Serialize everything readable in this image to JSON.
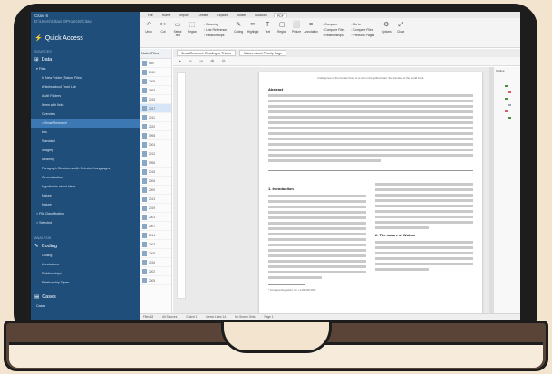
{
  "sidebar": {
    "app_title": "Citavi 6",
    "project_path": "D:\\Users\\Citavi 6\\Projects\\Citavi",
    "quick_access_label": "Quick Access",
    "section_sources": "SOURCES",
    "data_label": "Data",
    "files_label": "Files",
    "items": [
      {
        "label": "In New Folder (Saturn Files)",
        "active": false,
        "sub": false
      },
      {
        "label": "Articles about Trust Lab",
        "active": false,
        "sub": false
      },
      {
        "label": "Audit Folders",
        "active": false,
        "sub": false
      },
      {
        "label": "Items with links",
        "active": false,
        "sub": false
      },
      {
        "label": "Overview",
        "active": false,
        "sub": false
      },
      {
        "label": "> SmartResearch",
        "active": true,
        "sub": false
      },
      {
        "label": "bbs",
        "active": false,
        "sub": false
      },
      {
        "label": "Standard",
        "active": false,
        "sub": false
      },
      {
        "label": "Imagery",
        "active": false,
        "sub": false
      },
      {
        "label": "Meaning",
        "active": false,
        "sub": false
      },
      {
        "label": "Paragraph Structures with Selected Languages",
        "active": false,
        "sub": false
      },
      {
        "label": "Generalization",
        "active": false,
        "sub": false
      },
      {
        "label": "Hypothesis about ideas",
        "active": false,
        "sub": false
      },
      {
        "label": "Nature",
        "active": false,
        "sub": false
      },
      {
        "label": "Nature",
        "active": false,
        "sub": false
      },
      {
        "label": "> File Classification",
        "active": false,
        "sub": true
      },
      {
        "label": "> Selected",
        "active": false,
        "sub": true
      }
    ],
    "section_analysis": "ANALYSIS",
    "coding_label": "Coding",
    "coding_items": [
      "Coding",
      "Annotations",
      "Relationships",
      "Relationship Types"
    ],
    "cases_label": "Cases",
    "cases_sub": "Cases"
  },
  "ribbon": {
    "tabs": [
      "File",
      "Home",
      "Import",
      "Create",
      "Explore",
      "Share",
      "Modules",
      "PDF"
    ],
    "active_tab": "PDF",
    "tools": [
      {
        "icon": "↶",
        "label": "Undo"
      },
      {
        "icon": "✂",
        "label": "Cut"
      },
      {
        "icon": "▭",
        "label": "Select Text"
      },
      {
        "icon": "⬚",
        "label": "Region"
      }
    ],
    "group1": [
      "Cleaning",
      "Line Reference",
      "Relationships"
    ],
    "tools2": [
      {
        "icon": "✎",
        "label": "Coding"
      },
      {
        "icon": "✏",
        "label": "Highlight"
      },
      {
        "icon": "T",
        "label": "Text"
      },
      {
        "icon": "▢",
        "label": "Region"
      },
      {
        "icon": "⬜",
        "label": "Picture"
      },
      {
        "icon": "⌗",
        "label": "Annotation"
      }
    ],
    "group2": [
      "Compare",
      "Compare Files",
      "Relationships"
    ],
    "group3": [
      "Go to",
      "Compare Files",
      "Previous Pages"
    ],
    "tools3": [
      {
        "icon": "⚙",
        "label": "Options"
      },
      {
        "icon": "⤢",
        "label": "Close"
      }
    ]
  },
  "reflist": {
    "header": "Notes/Files",
    "rows": [
      "Fan",
      "2010",
      "2009",
      "1993",
      "2015",
      "2017",
      "2011",
      "2020",
      "1998",
      "2004",
      "2012",
      "1996",
      "2018",
      "2006",
      "2000",
      "2013",
      "2019",
      "2001",
      "2007",
      "2014",
      "2003",
      "2008",
      "2016",
      "2002",
      "2005"
    ],
    "active_index": 5
  },
  "doc_tabs": [
    "SmartResearch Reading to Thinks",
    "Nature about Priority Page"
  ],
  "doc_toolbar": [
    "⌖",
    "⇐",
    "⇒",
    "⊕",
    "⊖"
  ],
  "page": {
    "running_head": "Intelligence in the human brain is a unit in the global brain: the transfer of the world book",
    "abstract_title": "Abstract",
    "section1_title": "1. Introduction",
    "section2_title": "2. The nature of Wuhan",
    "footnote": "* Corresponding author. Tel: +1 000 000 0000"
  },
  "right_panel": {
    "title": "Outline",
    "marks": [
      {
        "color": "#4a8f3c"
      },
      {
        "color": "#d65a6a"
      },
      {
        "color": "#4a8f3c"
      },
      {
        "color": "#9ab"
      },
      {
        "color": "#d65a6a"
      },
      {
        "color": "#4a8f3c"
      }
    ]
  },
  "status": {
    "items": [
      "Files 18",
      "All Sources",
      "Coded 1",
      "Memo Lines 14",
      "No Search Sets",
      "Page 1"
    ]
  }
}
